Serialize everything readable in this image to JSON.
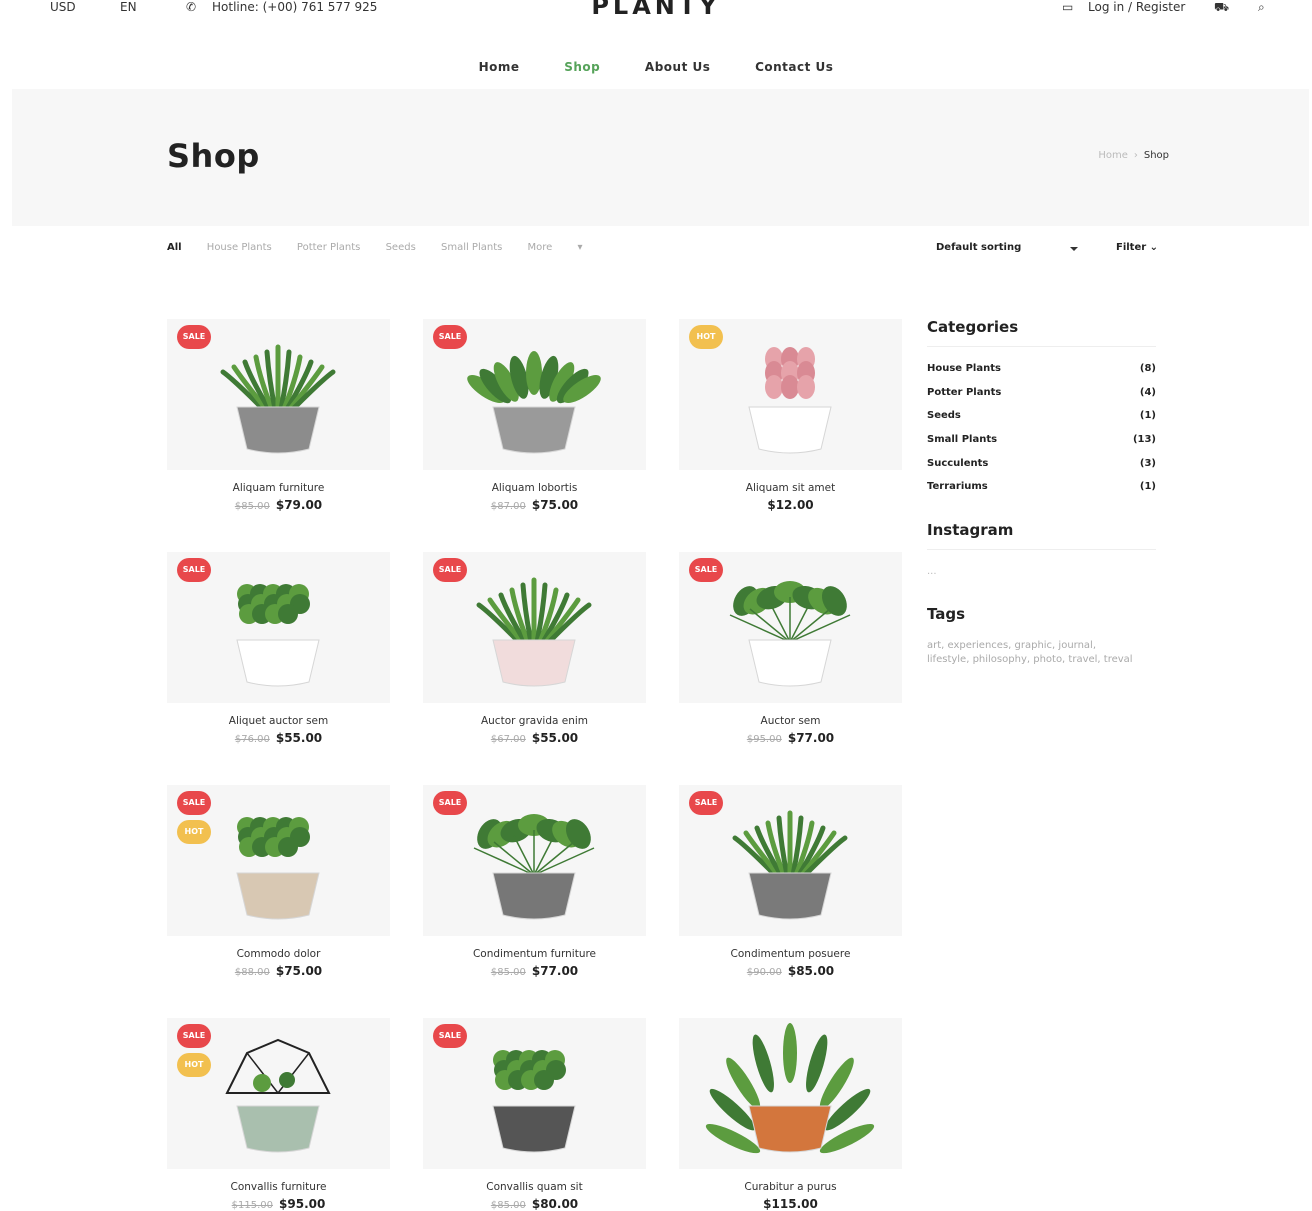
{
  "topbar": {
    "currency": "USD",
    "language": "EN",
    "hotline": "Hotline: (+00) 761 577 925",
    "login": "Log in / Register"
  },
  "logo": "PLANTY",
  "nav": [
    "Home",
    "Shop",
    "About Us",
    "Contact Us"
  ],
  "nav_active": "Shop",
  "hero": {
    "title": "Shop",
    "breadcrumb": [
      "Home",
      "Shop"
    ]
  },
  "filters": {
    "items": [
      "All",
      "House Plants",
      "Potter Plants",
      "Seeds",
      "Small Plants",
      "More"
    ],
    "sorting": "Default sorting",
    "filter_label": "Filter"
  },
  "products": [
    {
      "name": "Aliquam furniture",
      "old": "$85.00",
      "price": "$79.00",
      "badges": [
        "SALE"
      ],
      "pot": "#8c8c8c",
      "plant": "aloe"
    },
    {
      "name": "Aliquam lobortis",
      "old": "$87.00",
      "price": "$75.00",
      "badges": [
        "SALE"
      ],
      "pot": "#9a9a9a",
      "plant": "succulent"
    },
    {
      "name": "Aliquam sit amet",
      "old": "",
      "price": "$12.00",
      "badges": [
        "HOT"
      ],
      "pot": "#ffffff",
      "plant": "pink"
    },
    {
      "name": "Aliquet auctor sem",
      "old": "$76.00",
      "price": "$55.00",
      "badges": [
        "SALE"
      ],
      "pot": "#ffffff",
      "plant": "round"
    },
    {
      "name": "Auctor gravida enim",
      "old": "$67.00",
      "price": "$55.00",
      "badges": [
        "SALE"
      ],
      "pot": "#f1dcdc",
      "plant": "aloe"
    },
    {
      "name": "Auctor sem",
      "old": "$95.00",
      "price": "$77.00",
      "badges": [
        "SALE"
      ],
      "pot": "#ffffff",
      "plant": "leafy"
    },
    {
      "name": "Commodo dolor",
      "old": "$88.00",
      "price": "$75.00",
      "badges": [
        "SALE",
        "HOT"
      ],
      "pot": "#d8c8b3",
      "plant": "bush"
    },
    {
      "name": "Condimentum furniture",
      "old": "$85.00",
      "price": "$77.00",
      "badges": [
        "SALE"
      ],
      "pot": "#777777",
      "plant": "leafy"
    },
    {
      "name": "Condimentum posuere",
      "old": "$90.00",
      "price": "$85.00",
      "badges": [
        "SALE"
      ],
      "pot": "#7a7a7a",
      "plant": "aloe"
    },
    {
      "name": "Convallis furniture",
      "old": "$115.00",
      "price": "$95.00",
      "badges": [
        "SALE",
        "HOT"
      ],
      "pot": "#a9bfae",
      "plant": "terrarium"
    },
    {
      "name": "Convallis quam sit",
      "old": "$85.00",
      "price": "$80.00",
      "badges": [
        "SALE"
      ],
      "pot": "#555555",
      "plant": "bush"
    },
    {
      "name": "Curabitur a purus",
      "old": "",
      "price": "$115.00",
      "badges": [],
      "pot": "#d3763d",
      "plant": "fern"
    }
  ],
  "sidebar": {
    "categories_title": "Categories",
    "categories": [
      {
        "name": "House Plants",
        "count": "(8)"
      },
      {
        "name": "Potter Plants",
        "count": "(4)"
      },
      {
        "name": "Seeds",
        "count": "(1)"
      },
      {
        "name": "Small Plants",
        "count": "(13)"
      },
      {
        "name": "Succulents",
        "count": "(3)"
      },
      {
        "name": "Terrariums",
        "count": "(1)"
      }
    ],
    "instagram_title": "Instagram",
    "instagram_placeholder": "...",
    "tags_title": "Tags",
    "tags": "art, experiences, graphic, journal, lifestyle, philosophy, photo, travel, treval"
  },
  "colors": {
    "accent": "#56a35a",
    "sale": "#e8484b",
    "hot": "#f2c04f"
  }
}
